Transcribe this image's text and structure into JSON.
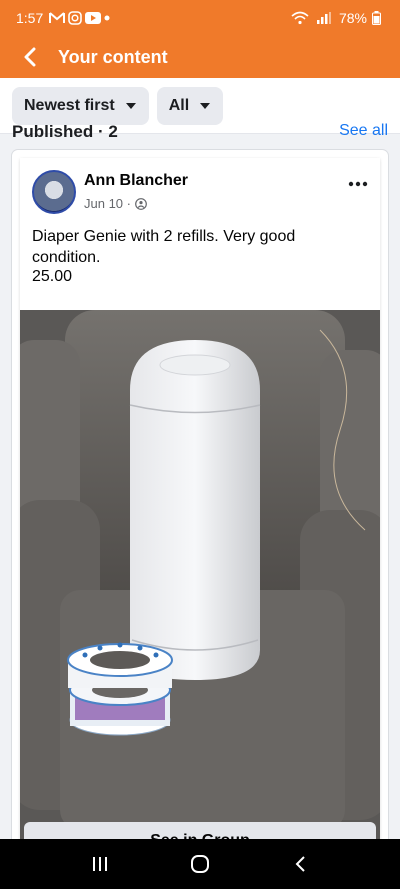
{
  "status_bar": {
    "time": "1:57",
    "battery": "78%",
    "icons": [
      "gmail-icon",
      "instagram-icon",
      "youtube-icon",
      "dot-icon",
      "wifi-icon",
      "signal-icon",
      "battery-icon"
    ]
  },
  "header": {
    "title": "Your content",
    "back_icon": "back-arrow-icon",
    "background": "#f07a2a"
  },
  "filters": {
    "sort": "Newest first",
    "type": "All"
  },
  "section": {
    "title": "Published · 2",
    "link": "See all"
  },
  "post": {
    "author": "Ann Blancher",
    "date": "Jun 10 ·",
    "privacy_icon": "group-privacy-icon",
    "text": "Diaper Genie with 2 refills. Very good condition.",
    "price": "25.00",
    "photo_alt": "Diaper Genie with refills"
  },
  "see_in_group": "See in Group",
  "colors": {
    "accent": "#f07a2a",
    "link": "#1877f2",
    "text": "#050505",
    "muted": "#65676b"
  }
}
